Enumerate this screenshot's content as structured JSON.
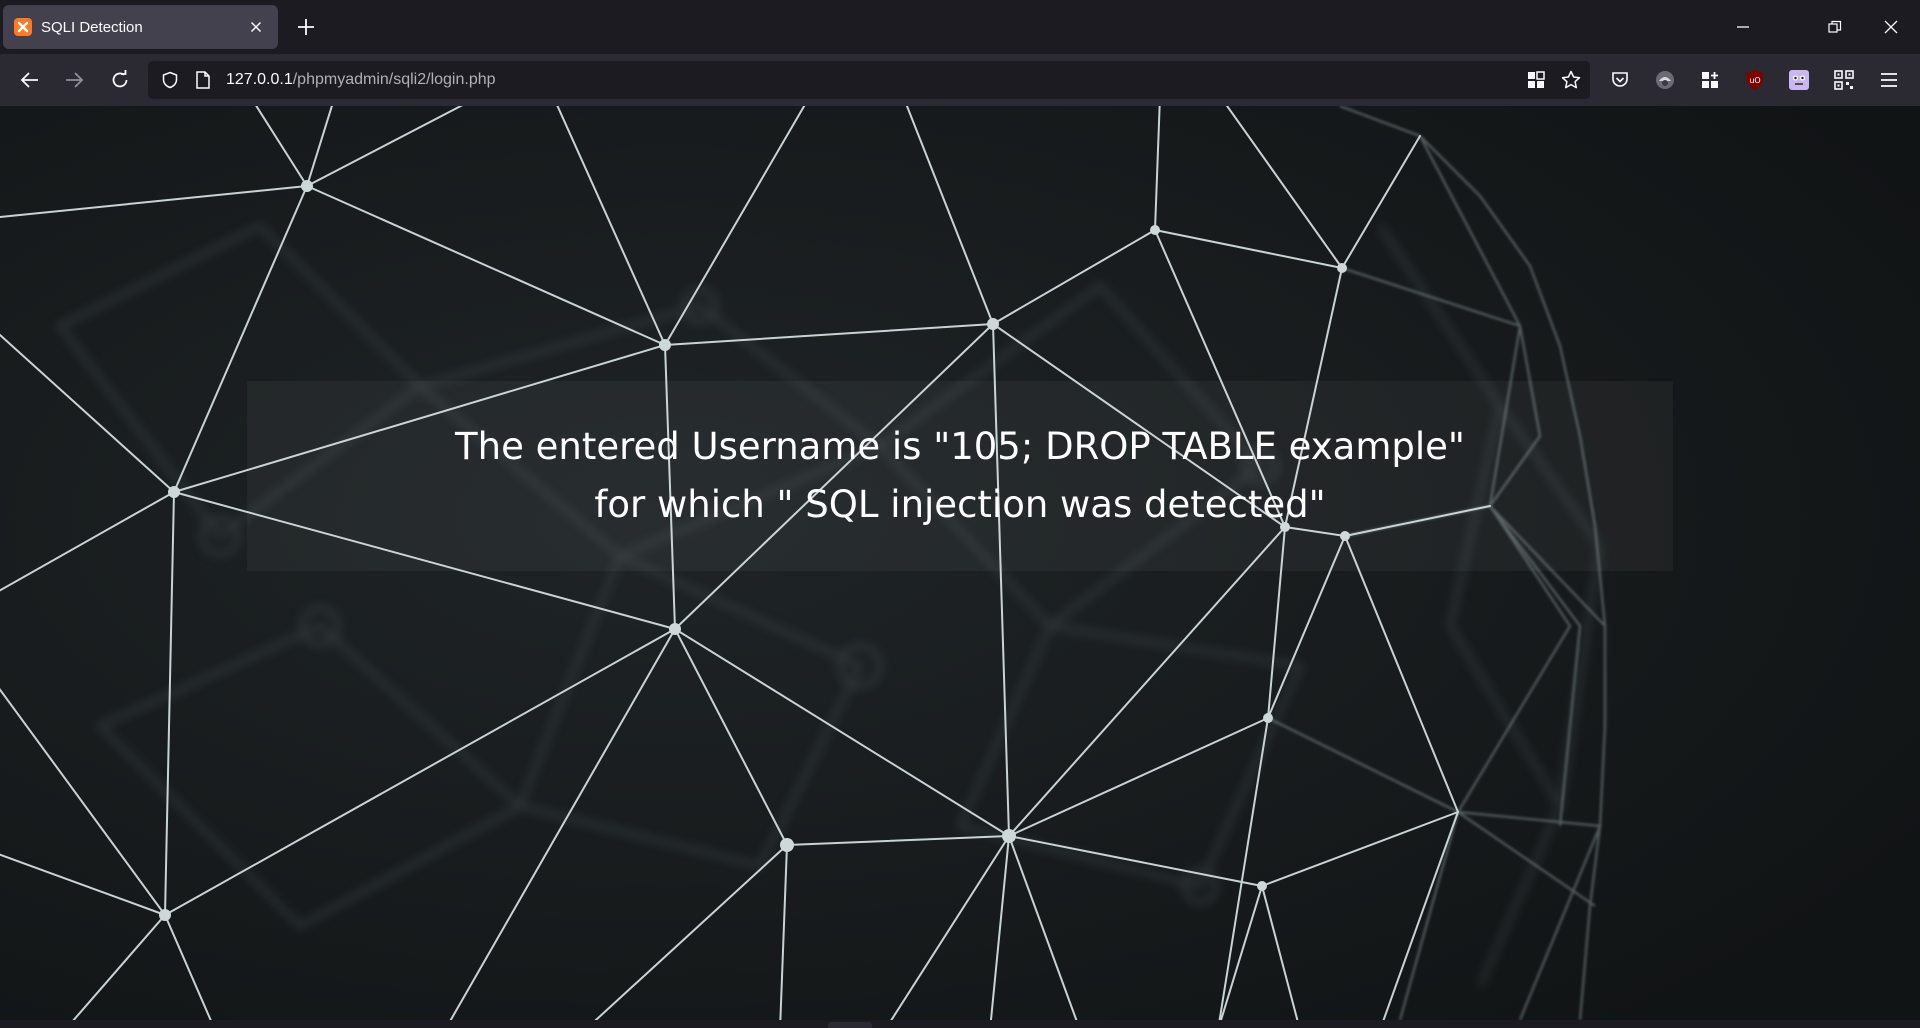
{
  "browser": {
    "tab": {
      "title": "SQLI Detection",
      "favicon": "xampp-icon"
    },
    "url": {
      "host": "127.0.0.1",
      "path": "/phpmyadmin/sqli2/login.php"
    },
    "toolbar_icons": [
      "qr-grid-icon",
      "star-icon",
      "pocket-icon",
      "extension-icon",
      "puzzle-grid-icon",
      "ublock-icon",
      "face-extension-icon",
      "qr-code-icon",
      "menu-icon"
    ]
  },
  "page": {
    "message": {
      "line1": "The entered Username is \"105; DROP TABLE example\"",
      "line2": "for which \" SQL injection was detected\""
    }
  },
  "colors": {
    "tab_strip": "#1c1b22",
    "navbar": "#2b2a33",
    "page_bg": "#151819",
    "network_lines": "#c9d3d3",
    "favicon": "#fb7a24"
  }
}
